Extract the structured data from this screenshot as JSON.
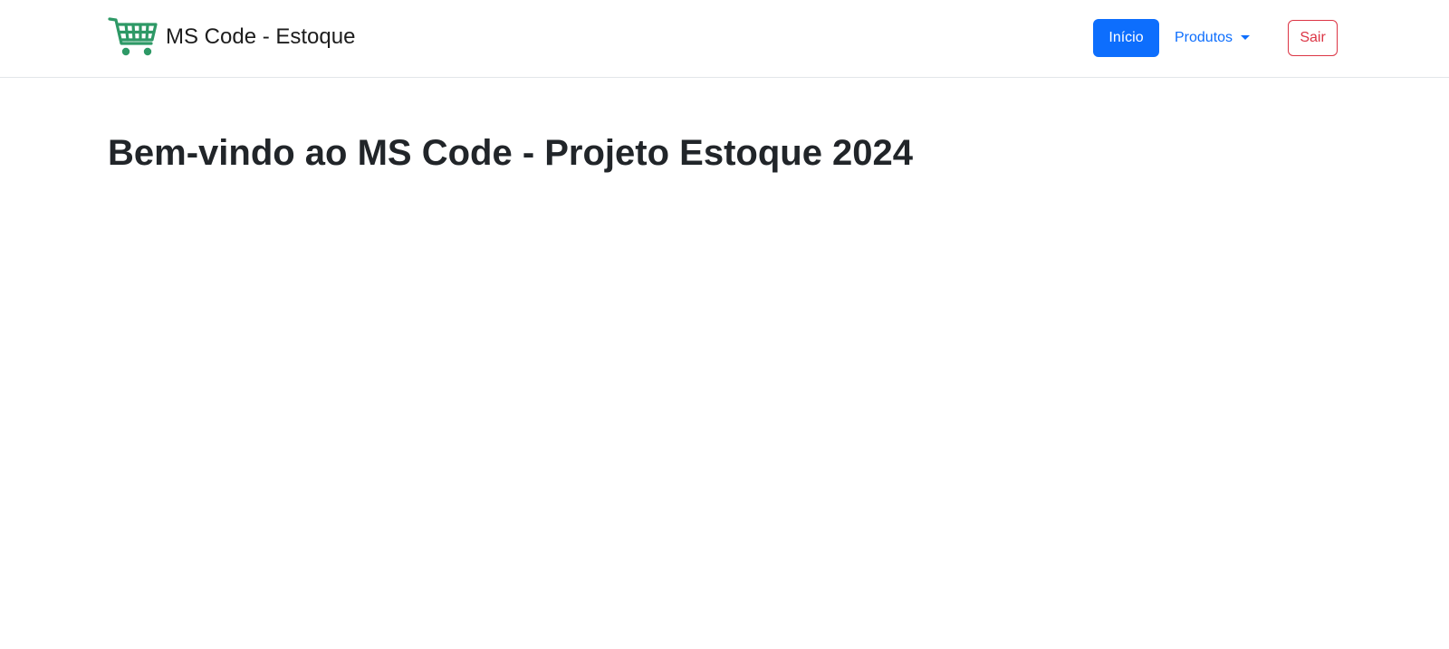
{
  "navbar": {
    "brand": {
      "icon": "shopping-cart-icon",
      "title": "MS Code - Estoque",
      "icon_color": "#2e9966"
    },
    "links": {
      "home_label": "Início",
      "products_label": "Produtos",
      "logout_label": "Sair"
    },
    "colors": {
      "primary": "#0d6efd",
      "danger": "#dc3545"
    }
  },
  "main": {
    "heading": "Bem-vindo ao MS Code - Projeto Estoque 2024"
  }
}
